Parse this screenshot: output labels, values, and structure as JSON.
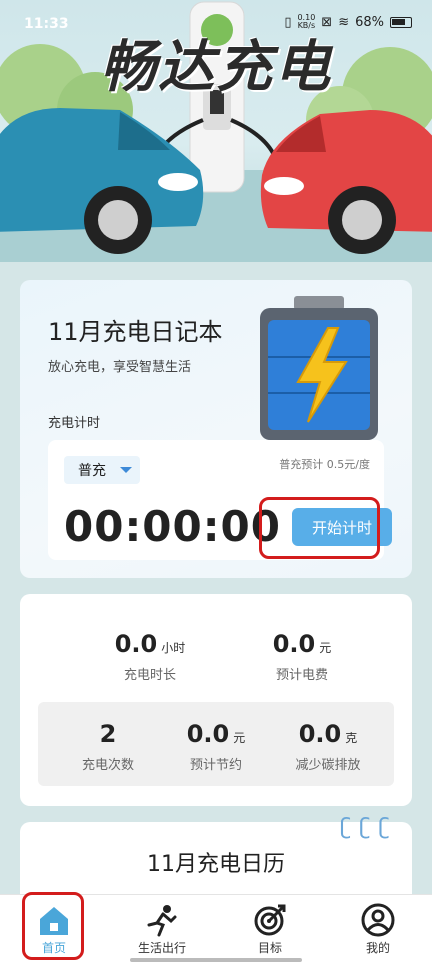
{
  "status_bar": {
    "time": "11:33",
    "speed_value": "0.10",
    "speed_unit": "KB/s",
    "battery": "68%"
  },
  "hero": {
    "title": "畅达充电"
  },
  "diary": {
    "title": "11月充电日记本",
    "subtitle": "放心充电，享受智慧生活",
    "timer_label": "充电计时",
    "mode": "普充",
    "price_hint": "普充预计 0.5元/度",
    "timer": "00:00:00",
    "start_button": "开始计时"
  },
  "stats": {
    "duration": {
      "value": "0.0",
      "unit": "小时",
      "label": "充电时长"
    },
    "cost": {
      "value": "0.0",
      "unit": "元",
      "label": "预计电费"
    },
    "count": {
      "value": "2",
      "label": "充电次数"
    },
    "savings": {
      "value": "0.0",
      "unit": "元",
      "label": "预计节约"
    },
    "carbon": {
      "value": "0.0",
      "unit": "克",
      "label": "减少碳排放"
    }
  },
  "calendar": {
    "title": "11月充电日历"
  },
  "tabs": [
    {
      "label": "首页",
      "icon": "home-icon",
      "active": true
    },
    {
      "label": "生活出行",
      "icon": "running-person-icon",
      "active": false
    },
    {
      "label": "目标",
      "icon": "target-icon",
      "active": false
    },
    {
      "label": "我的",
      "icon": "user-icon",
      "active": false
    }
  ],
  "colors": {
    "accent": "#4aa6d9",
    "button": "#58aee8",
    "highlight": "#d31c1c"
  }
}
